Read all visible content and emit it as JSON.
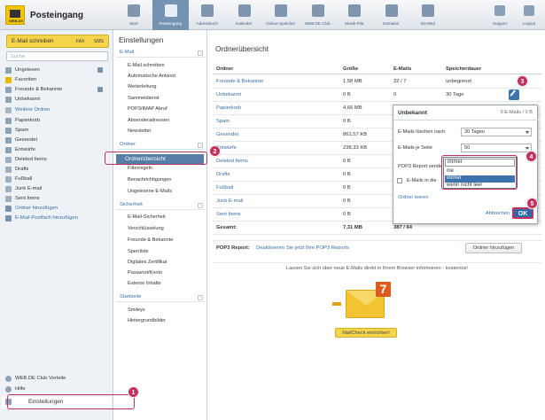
{
  "brand": {
    "title": "Posteingang",
    "logo_text": "WEB.DE"
  },
  "topnav": [
    {
      "label": "Start",
      "icon": "home-icon"
    },
    {
      "label": "Posteingang",
      "icon": "mail-icon",
      "active": true
    },
    {
      "label": "Adressbuch",
      "icon": "addressbook-icon"
    },
    {
      "label": "Kalender",
      "icon": "calendar-icon"
    },
    {
      "label": "Online-Speicher",
      "icon": "cloud-icon"
    },
    {
      "label": "WEB.DE Club",
      "icon": "club-icon"
    },
    {
      "label": "Musik-Flat",
      "icon": "music-icon"
    },
    {
      "label": "Domains",
      "icon": "domains-icon"
    },
    {
      "label": "De-Mail",
      "icon": "demail-icon"
    }
  ],
  "topnav_right": [
    {
      "label": "Support"
    },
    {
      "label": "Logout"
    }
  ],
  "left": {
    "write_label": "E-Mail schreiben",
    "fax_label": "FAX",
    "sms_label": "SMS",
    "search_placeholder": "Suche",
    "folders": [
      {
        "label": "Ungelesen",
        "icon": "unread-icon"
      },
      {
        "label": "Favoriten",
        "icon": "star-icon"
      },
      {
        "label": "Freunde & Bekannte",
        "icon": "friends-icon"
      },
      {
        "label": "Unbekannt",
        "icon": "unknown-icon"
      },
      {
        "label": "Weitere Ordner",
        "icon": "minus-icon",
        "sub": true
      },
      {
        "label": "Papierkorb",
        "icon": "trash-icon"
      },
      {
        "label": "Spam",
        "icon": "spam-icon"
      },
      {
        "label": "Gesendet",
        "icon": "sent-icon"
      },
      {
        "label": "Entwürfe",
        "icon": "draft-icon"
      },
      {
        "label": "Deleted Items",
        "icon": "folder-icon"
      },
      {
        "label": "Drafts",
        "icon": "folder-icon"
      },
      {
        "label": "Fußball",
        "icon": "folder-icon"
      },
      {
        "label": "Junk E-mail",
        "icon": "folder-icon"
      },
      {
        "label": "Sent Items",
        "icon": "folder-icon"
      },
      {
        "label": "Ordner hinzufügen",
        "icon": "plus-icon",
        "sub": true
      },
      {
        "label": "E-Mail-Postfach hinzufügen",
        "icon": "plus-icon",
        "sub": true
      }
    ],
    "bottom": [
      {
        "label": "WEB.DE Club Vorteile",
        "icon": "club-icon"
      },
      {
        "label": "Hilfe",
        "icon": "help-icon"
      },
      {
        "label": "Einstellungen",
        "icon": "wrench-icon"
      }
    ]
  },
  "mid": {
    "title": "Einstellungen",
    "sections": [
      {
        "label": "E-Mail",
        "items": [
          "E-Mail schreiben",
          "Automatische Antwort",
          "Weiterleitung",
          "Sammeldienst",
          "POP3/IMAP Abruf",
          "Absenderadressen",
          "Newsletter"
        ]
      },
      {
        "label": "Ordner",
        "items": [
          "Ordnerübersicht",
          "Filterregeln",
          "Benachrichtigungen",
          "Ungelesene E-Mails"
        ]
      },
      {
        "label": "Sicherheit",
        "items": [
          "E-Mail-Sicherheit",
          "Verschlüsselung",
          "Freunde & Bekannte",
          "Sperrliste",
          "Digitales Zertifikat",
          "Passwort/Konto",
          "Externe Inhalte"
        ]
      },
      {
        "label": "Startseite",
        "items": [
          "Smileys",
          "Hintergrundbilder"
        ]
      }
    ]
  },
  "main": {
    "title": "Ordnerübersicht",
    "headers": {
      "name": "Ordner",
      "size": "Größe",
      "mails": "E-Mails",
      "storage": "Speicherdauer"
    },
    "rows": [
      {
        "name": "Freunde & Bekannte",
        "size": "1,58 MB",
        "mails": "32 / 7",
        "storage": "unbegrenzt"
      },
      {
        "name": "Unbekannt",
        "size": "0 B",
        "mails": "0",
        "storage": "30 Tage"
      },
      {
        "name": "Papierkorb",
        "size": "4,66 MB",
        "mails": "",
        "storage": ""
      },
      {
        "name": "Spam",
        "size": "0 B",
        "mails": "",
        "storage": ""
      },
      {
        "name": "Gesendet",
        "size": "861,57 KB",
        "mails": "",
        "storage": ""
      },
      {
        "name": "Entwürfe",
        "size": "238,33 KB",
        "mails": "",
        "storage": ""
      },
      {
        "name": "Deleted Items",
        "size": "0 B",
        "mails": "",
        "storage": ""
      },
      {
        "name": "Drafts",
        "size": "0 B",
        "mails": "",
        "storage": ""
      },
      {
        "name": "Fußball",
        "size": "0 B",
        "mails": "",
        "storage": ""
      },
      {
        "name": "Junk E-mail",
        "size": "0 B",
        "mails": "",
        "storage": ""
      },
      {
        "name": "Sent Items",
        "size": "0 B",
        "mails": "",
        "storage": ""
      }
    ],
    "total": {
      "label": "Gesamt:",
      "size": "7,31 MB",
      "mails": "387 / 64"
    },
    "pop3": {
      "label": "POP3 Report:",
      "text": "Deaktivieren Sie jetzt Ihre POP3 Reports",
      "add_button": "Ordner hinzufügen"
    },
    "promo": {
      "text": "Lassen Sie sich über neue E-Mails direkt in Ihrem Browser informieren - kostenlos!",
      "button": "MailCheck einrichten!",
      "badge": "7"
    }
  },
  "dialog": {
    "title": "Unbekannt",
    "info": "0 E-Mails / 0 B",
    "delete_label": "E-Mails löschen nach",
    "delete_value": "30 Tagen",
    "perpage_label": "E-Mails je Seite",
    "perpage_value": "50",
    "pop3_label": "POP3 Report sende",
    "checkbox_label": "E-Mails in die",
    "empty_link": "Ordner leeren",
    "cancel": "Abbrechen",
    "ok": "OK",
    "select_value": "immer",
    "options": [
      "nie",
      "immer",
      "wenn nicht leer"
    ]
  },
  "badges": [
    "1",
    "2",
    "3",
    "4",
    "5"
  ]
}
